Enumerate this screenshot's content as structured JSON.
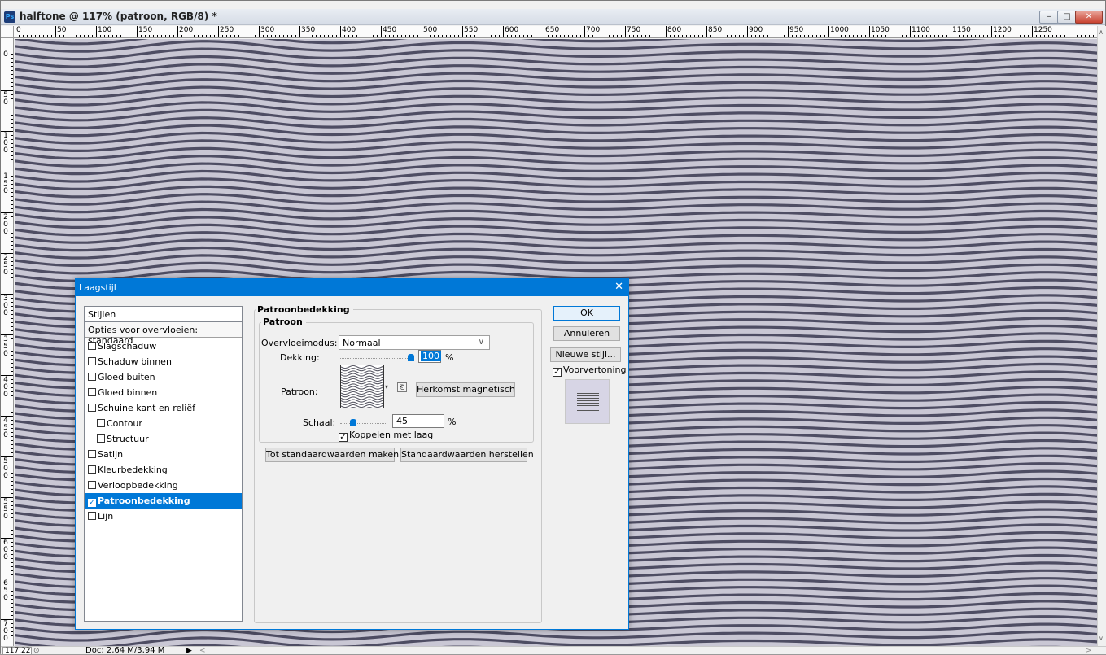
{
  "window": {
    "title": "halftone @ 117% (patroon, RGB/8) *",
    "app_icon": "Ps",
    "min_icon": "minimize-icon",
    "max_icon": "maximize-icon",
    "close_icon": "close-icon"
  },
  "rulers": {
    "h_ticks": [
      "0",
      "50",
      "100",
      "150",
      "200",
      "250",
      "300",
      "350",
      "400",
      "450",
      "500",
      "550",
      "600",
      "650",
      "700",
      "750",
      "800",
      "850",
      "900",
      "950",
      "1000",
      "1050",
      "1100",
      "1150",
      "1200",
      "1250"
    ],
    "v_ticks": [
      "0",
      "50",
      "100",
      "150",
      "200",
      "250",
      "300",
      "350",
      "400",
      "450",
      "500",
      "550",
      "600",
      "650",
      "700"
    ]
  },
  "status": {
    "zoom": "117,22",
    "doc": "Doc: 2,64 M/3,94 M"
  },
  "dialog": {
    "title": "Laagstijl",
    "styles_header": "Stijlen",
    "blend_options": "Opties voor overvloeien: standaard",
    "items": [
      {
        "label": "Slagschaduw",
        "checked": false,
        "indent": false
      },
      {
        "label": "Schaduw binnen",
        "checked": false,
        "indent": false
      },
      {
        "label": "Gloed buiten",
        "checked": false,
        "indent": false
      },
      {
        "label": "Gloed binnen",
        "checked": false,
        "indent": false
      },
      {
        "label": "Schuine kant en reliëf",
        "checked": false,
        "indent": false
      },
      {
        "label": "Contour",
        "checked": false,
        "indent": true
      },
      {
        "label": "Structuur",
        "checked": false,
        "indent": true
      },
      {
        "label": "Satijn",
        "checked": false,
        "indent": false
      },
      {
        "label": "Kleurbedekking",
        "checked": false,
        "indent": false
      },
      {
        "label": "Verloopbedekking",
        "checked": false,
        "indent": false
      },
      {
        "label": "Patroonbedekking",
        "checked": true,
        "indent": false,
        "selected": true
      },
      {
        "label": "Lijn",
        "checked": false,
        "indent": false
      }
    ],
    "section_title": "Patroonbedekking",
    "group_title": "Patroon",
    "blend_mode_label": "Overvloeimodus:",
    "blend_mode_value": "Normaal",
    "opacity_label": "Dekking:",
    "opacity_value": "100",
    "opacity_unit": "%",
    "opacity_level": 1.0,
    "pattern_label": "Patroon:",
    "snap_origin_button": "Herkomst magnetisch",
    "scale_label": "Schaal:",
    "scale_value": "45",
    "scale_unit": "%",
    "scale_level": 0.45,
    "link_with_layer": "Koppelen met laag",
    "make_default_button": "Tot standaardwaarden maken",
    "reset_default_button": "Standaardwaarden herstellen",
    "ok_button": "OK",
    "cancel_button": "Annuleren",
    "new_style_button": "Nieuwe stijl...",
    "preview_label": "Voorvertoning"
  },
  "colors": {
    "accent": "#0078d7",
    "canvas": "#c9c7d4",
    "stripe": "#4e4d63"
  }
}
